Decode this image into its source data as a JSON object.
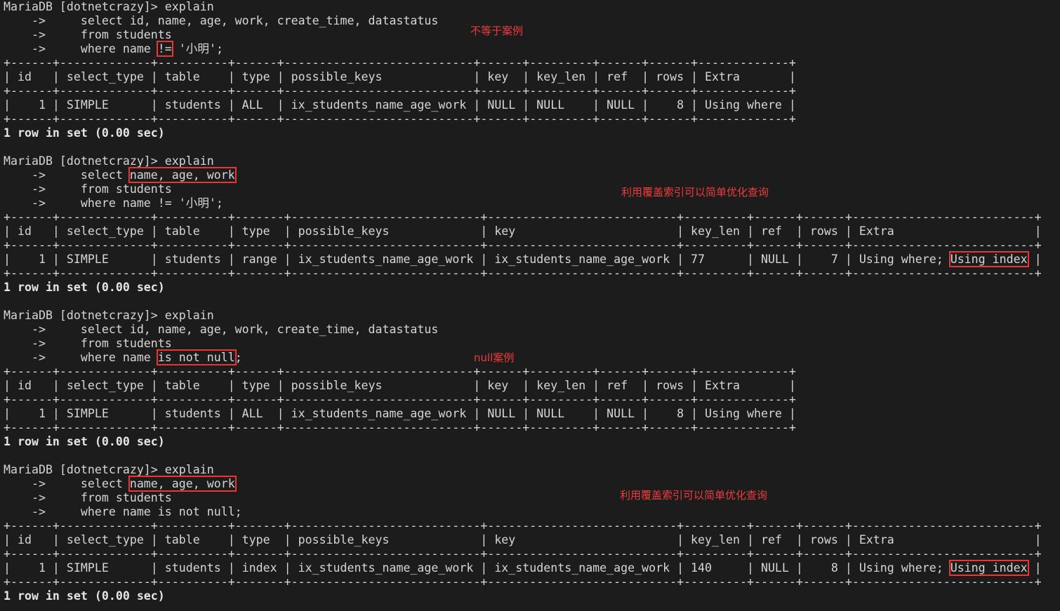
{
  "colors": {
    "background": "#1c1c1c",
    "text": "#d6d6d6",
    "highlight": "#ee3535"
  },
  "blocks": [
    {
      "lines": [
        {
          "pre": "MariaDB [dotnetcrazy]> explain"
        },
        {
          "pre": "    ->     select id, name, age, work, create_time, datastatus"
        },
        {
          "pre": "    ->     from students"
        },
        {
          "pre": "    ->     where name ",
          "box": "!=",
          "post": " '小明';"
        },
        {
          "pre": "+------+-------------+----------+------+---------------------------+------+---------+------+------+-------------+"
        },
        {
          "pre": "| id   | select_type | table    | type | possible_keys             | key  | key_len | ref  | rows | Extra       |"
        },
        {
          "pre": "+------+-------------+----------+------+---------------------------+------+---------+------+------+-------------+"
        },
        {
          "pre": "|    1 | SIMPLE      | students | ALL  | ix_students_name_age_work | NULL | NULL    | NULL |    8 | Using where |"
        },
        {
          "pre": "+------+-------------+----------+------+---------------------------+------+---------+------+------+-------------+"
        },
        {
          "pre": "1 row in set (0.00 sec)",
          "bold": true
        }
      ],
      "note": "不等于案例"
    },
    {
      "lines": [
        {
          "pre": "MariaDB [dotnetcrazy]> explain"
        },
        {
          "pre": "    ->     select ",
          "box": "name, age, work",
          "post": ""
        },
        {
          "pre": "    ->     from students"
        },
        {
          "pre": "    ->     where name != '小明';"
        },
        {
          "pre": "+------+-------------+----------+-------+---------------------------+---------------------------+---------+------+------+--------------------------+"
        },
        {
          "pre": "| id   | select_type | table    | type  | possible_keys             | key                       | key_len | ref  | rows | Extra                    |"
        },
        {
          "pre": "+------+-------------+----------+-------+---------------------------+---------------------------+---------+------+------+--------------------------+"
        },
        {
          "pre": "|    1 | SIMPLE      | students | range | ix_students_name_age_work | ix_students_name_age_work | 77      | NULL |    7 | Using where; ",
          "box": "Using index",
          "post": " |"
        },
        {
          "pre": "+------+-------------+----------+-------+---------------------------+---------------------------+---------+------+------+--------------------------+"
        },
        {
          "pre": "1 row in set (0.00 sec)",
          "bold": true
        }
      ],
      "note": "利用覆盖索引可以简单优化查询"
    },
    {
      "lines": [
        {
          "pre": "MariaDB [dotnetcrazy]> explain"
        },
        {
          "pre": "    ->     select id, name, age, work, create_time, datastatus"
        },
        {
          "pre": "    ->     from students"
        },
        {
          "pre": "    ->     where name ",
          "box": "is not null",
          "post": ";"
        },
        {
          "pre": "+------+-------------+----------+------+---------------------------+------+---------+------+------+-------------+"
        },
        {
          "pre": "| id   | select_type | table    | type | possible_keys             | key  | key_len | ref  | rows | Extra       |"
        },
        {
          "pre": "+------+-------------+----------+------+---------------------------+------+---------+------+------+-------------+"
        },
        {
          "pre": "|    1 | SIMPLE      | students | ALL  | ix_students_name_age_work | NULL | NULL    | NULL |    8 | Using where |"
        },
        {
          "pre": "+------+-------------+----------+------+---------------------------+------+---------+------+------+-------------+"
        },
        {
          "pre": "1 row in set (0.00 sec)",
          "bold": true
        }
      ],
      "note": "null案例"
    },
    {
      "lines": [
        {
          "pre": "MariaDB [dotnetcrazy]> explain"
        },
        {
          "pre": "    ->     select ",
          "box": "name, age, work",
          "post": ""
        },
        {
          "pre": "    ->     from students"
        },
        {
          "pre": "    ->     where name is not null;"
        },
        {
          "pre": "+------+-------------+----------+-------+---------------------------+---------------------------+---------+------+------+--------------------------+"
        },
        {
          "pre": "| id   | select_type | table    | type  | possible_keys             | key                       | key_len | ref  | rows | Extra                    |"
        },
        {
          "pre": "+------+-------------+----------+-------+---------------------------+---------------------------+---------+------+------+--------------------------+"
        },
        {
          "pre": "|    1 | SIMPLE      | students | index | ix_students_name_age_work | ix_students_name_age_work | 140     | NULL |    8 | Using where; ",
          "box": "Using index",
          "post": " |"
        },
        {
          "pre": "+------+-------------+----------+-------+---------------------------+---------------------------+---------+------+------+--------------------------+"
        },
        {
          "pre": "1 row in set (0.00 sec)",
          "bold": true
        }
      ],
      "note": "利用覆盖索引可以简单优化查询"
    }
  ]
}
